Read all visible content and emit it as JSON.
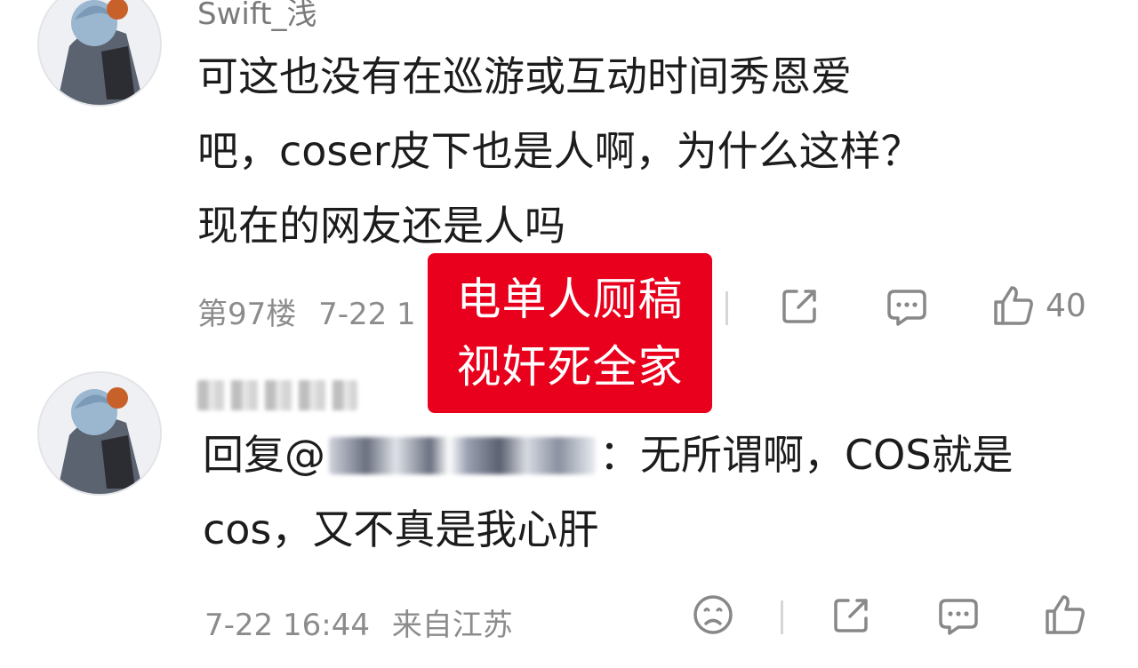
{
  "comments": [
    {
      "username": "Swift_浅",
      "text_lines": [
        "可这也没有在巡游或互动时间秀恩爱",
        "吧，coser皮下也是人啊，为什么这样？",
        "现在的网友还是人吗"
      ],
      "floor": "第97楼",
      "time": "7-22 1",
      "like_count": "40"
    },
    {
      "reply_prefix": "回复@",
      "reply_text_after_mention": "：无所谓啊，COS就是",
      "reply_line2": "cos，又不真是我心肝",
      "time": "7-22 16:44",
      "location": "来自江苏"
    }
  ],
  "overlay": {
    "line1": "电单人厕稿",
    "line2": "视奸死全家",
    "color": "#e8001c"
  },
  "icons": {
    "share": "share-icon",
    "comment": "comment-icon",
    "like": "thumbs-up-icon",
    "dislike": "sad-face-icon"
  }
}
